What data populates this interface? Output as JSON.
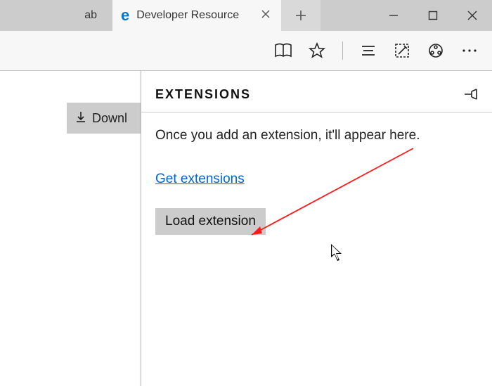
{
  "tabs": {
    "inactive_suffix": "ab",
    "active_title": "Developer Resource"
  },
  "download_label": "Downl",
  "panel": {
    "title": "EXTENSIONS",
    "message": "Once you add an extension, it'll appear here.",
    "get_link": "Get extensions",
    "load_button": "Load extension"
  }
}
